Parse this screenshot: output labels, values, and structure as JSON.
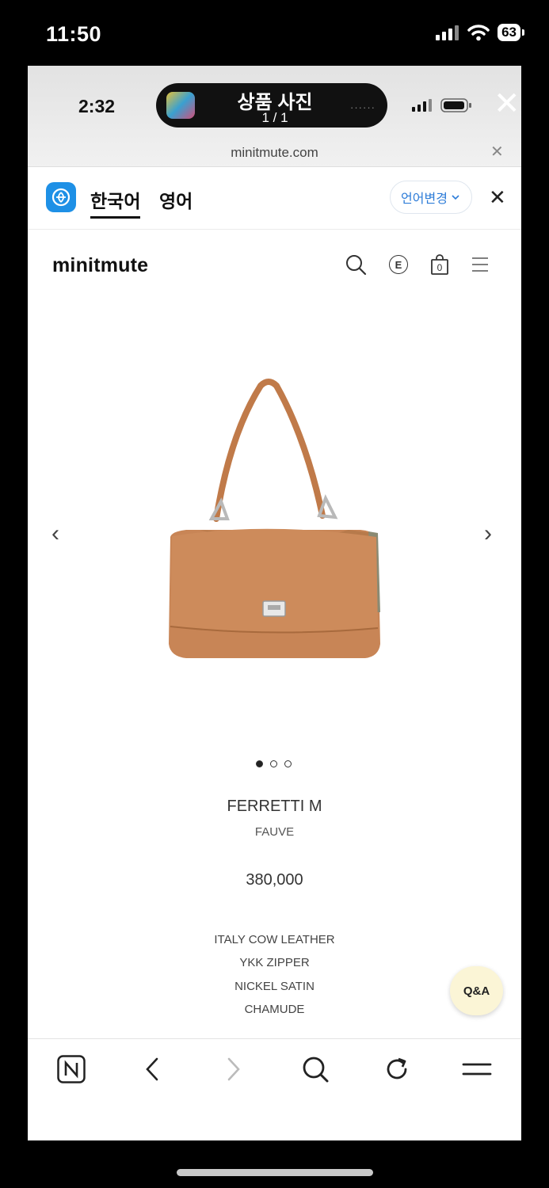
{
  "device": {
    "time": "11:50",
    "battery": "63"
  },
  "viewer": {
    "time": "2:32",
    "title": "상품 사진",
    "count": "1 / 1",
    "dots": "······",
    "close": "✕"
  },
  "browser": {
    "url": "minitmute.com",
    "url_close": "✕"
  },
  "translate": {
    "lang_korean": "한국어",
    "lang_english": "영어",
    "change_button": "언어변경",
    "close": "✕"
  },
  "site": {
    "logo": "minitmute",
    "cart_count": "0",
    "currency_badge": "E"
  },
  "product": {
    "name": "FERRETTI M",
    "color": "FAUVE",
    "price": "380,000",
    "details": [
      "ITALY COW LEATHER",
      "YKK ZIPPER",
      "NICKEL SATIN",
      "CHAMUDE"
    ],
    "image_index": 1,
    "image_total": 3
  },
  "qa_button": "Q&A",
  "colors": {
    "bag": "#c88556",
    "accent_blue": "#1e90e6"
  }
}
